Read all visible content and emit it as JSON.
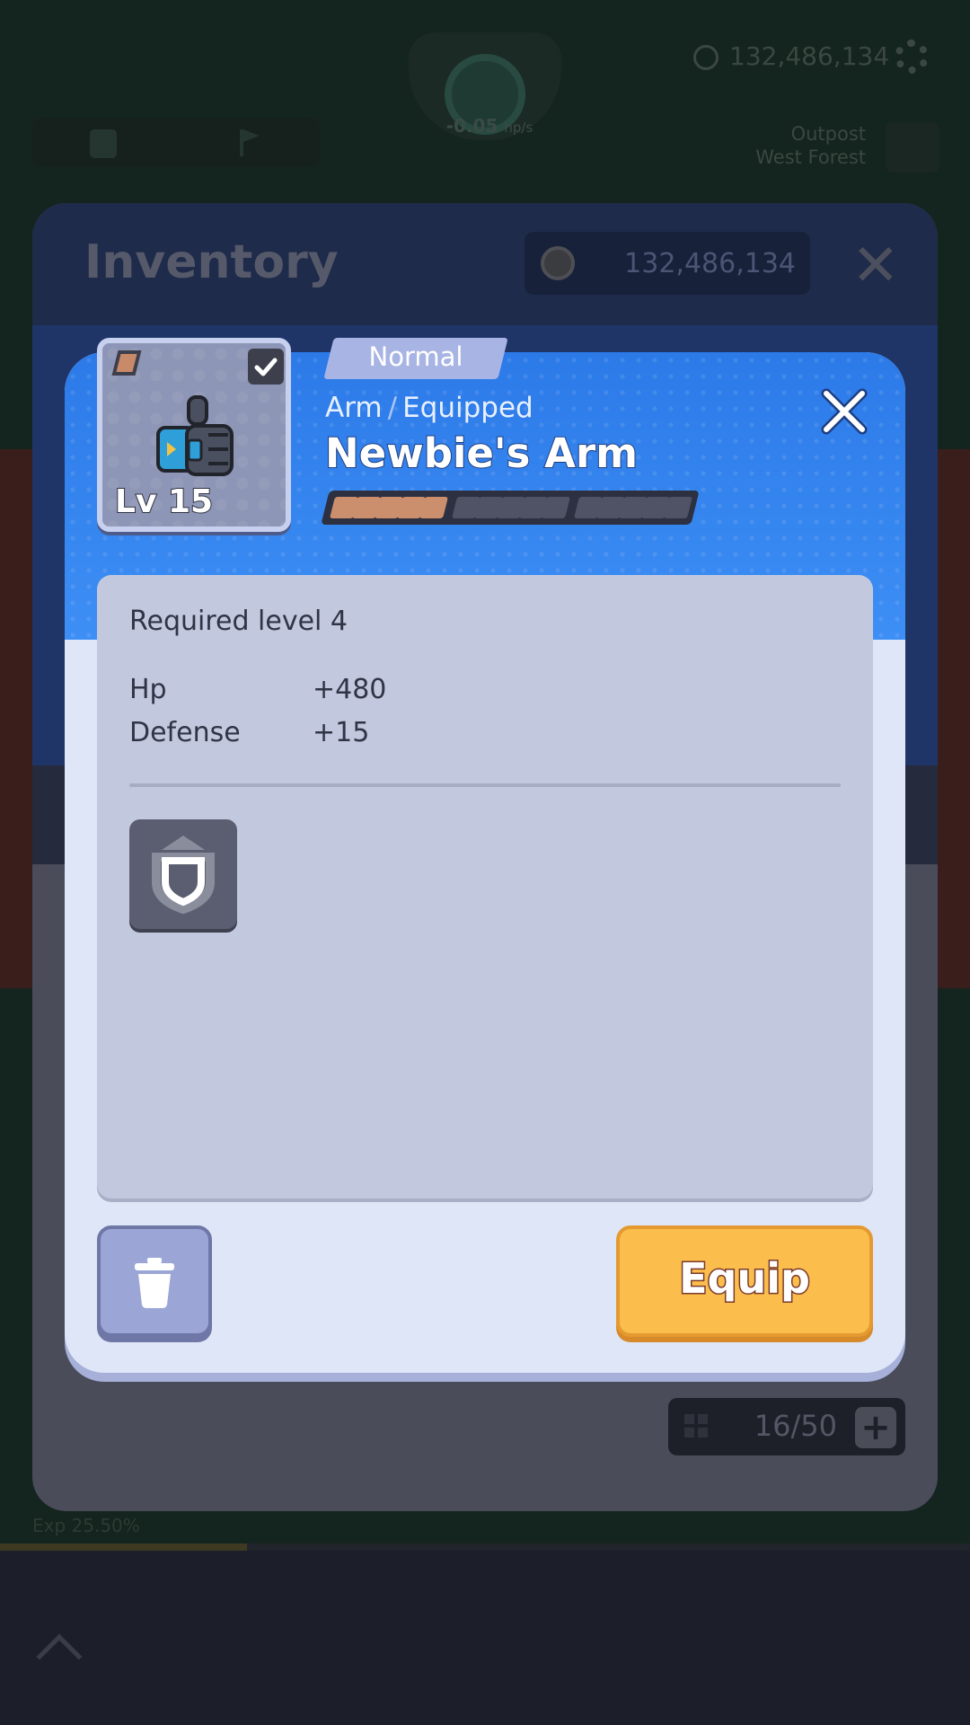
{
  "hud": {
    "coins": "132,486,134",
    "rate_value": "-0.05",
    "rate_unit": "hp/s",
    "location_line1": "Outpost",
    "location_line2": "West Forest"
  },
  "inventory": {
    "title": "Inventory",
    "coins": "132,486,134",
    "capacity": "16/50",
    "exp_text": "Exp 25.50%",
    "exp_percent": 25.5
  },
  "item": {
    "rarity": "Normal",
    "slot_type": "Arm",
    "separator": "/",
    "status": "Equipped",
    "name": "Newbie's Arm",
    "level": "Lv 15",
    "upgrade_pips_filled": 5,
    "upgrade_pips_total": 15,
    "required_level": "Required level 4",
    "stats": [
      {
        "name": "Hp",
        "value": "+480"
      },
      {
        "name": "Defense",
        "value": "+15"
      }
    ],
    "skill_icon": "shield-skill-icon"
  },
  "actions": {
    "equip_label": "Equip",
    "delete_icon": "trash-icon"
  },
  "colors": {
    "modal_header_blue": "#3d8ef5",
    "equip_yellow": "#fbbe4c",
    "pip_filled": "#cc8f6e",
    "pip_empty": "#4f5365"
  }
}
